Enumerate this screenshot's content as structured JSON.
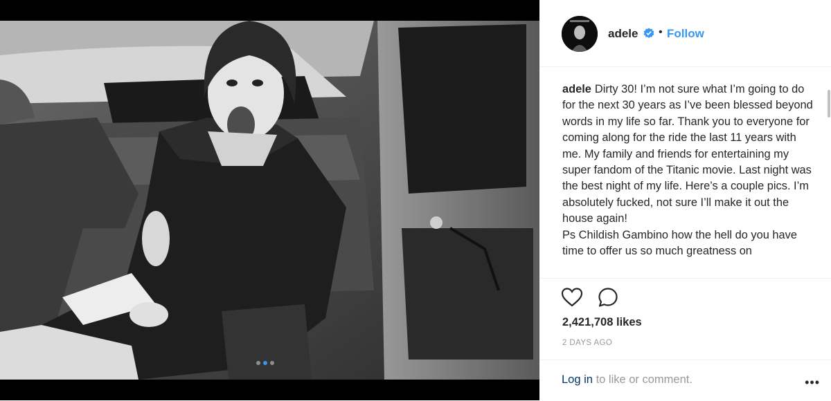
{
  "photo": {
    "description_icon": "photo-of-woman-in-car",
    "carousel_count": 3,
    "carousel_active_index": 2
  },
  "header": {
    "username": "adele",
    "separator": "•",
    "follow_label": "Follow",
    "verified_icon": "verified-badge-icon",
    "accent_color": "#3897f0"
  },
  "caption": {
    "username": "adele",
    "text": "Dirty 30! I’m not sure what I’m going to do for the next 30 years as I’ve been blessed beyond words in my life so far. Thank you to everyone for coming along for the ride the last 11 years with me. My family and friends for entertaining my super fandom of the Titanic movie. Last night was the best night of my life. Here’s a couple pics. I’m absolutely fucked, not sure I’ll make it out the house again!",
    "text2": "Ps Childish Gambino how the hell do you have time to offer us so much greatness on"
  },
  "actions": {
    "like_icon": "heart-icon",
    "comment_icon": "comment-icon",
    "likes": "2,421,708 likes",
    "timestamp": "2 DAYS AGO"
  },
  "footer": {
    "login_link": "Log in",
    "login_rest": "to like or comment.",
    "more": "•••"
  }
}
